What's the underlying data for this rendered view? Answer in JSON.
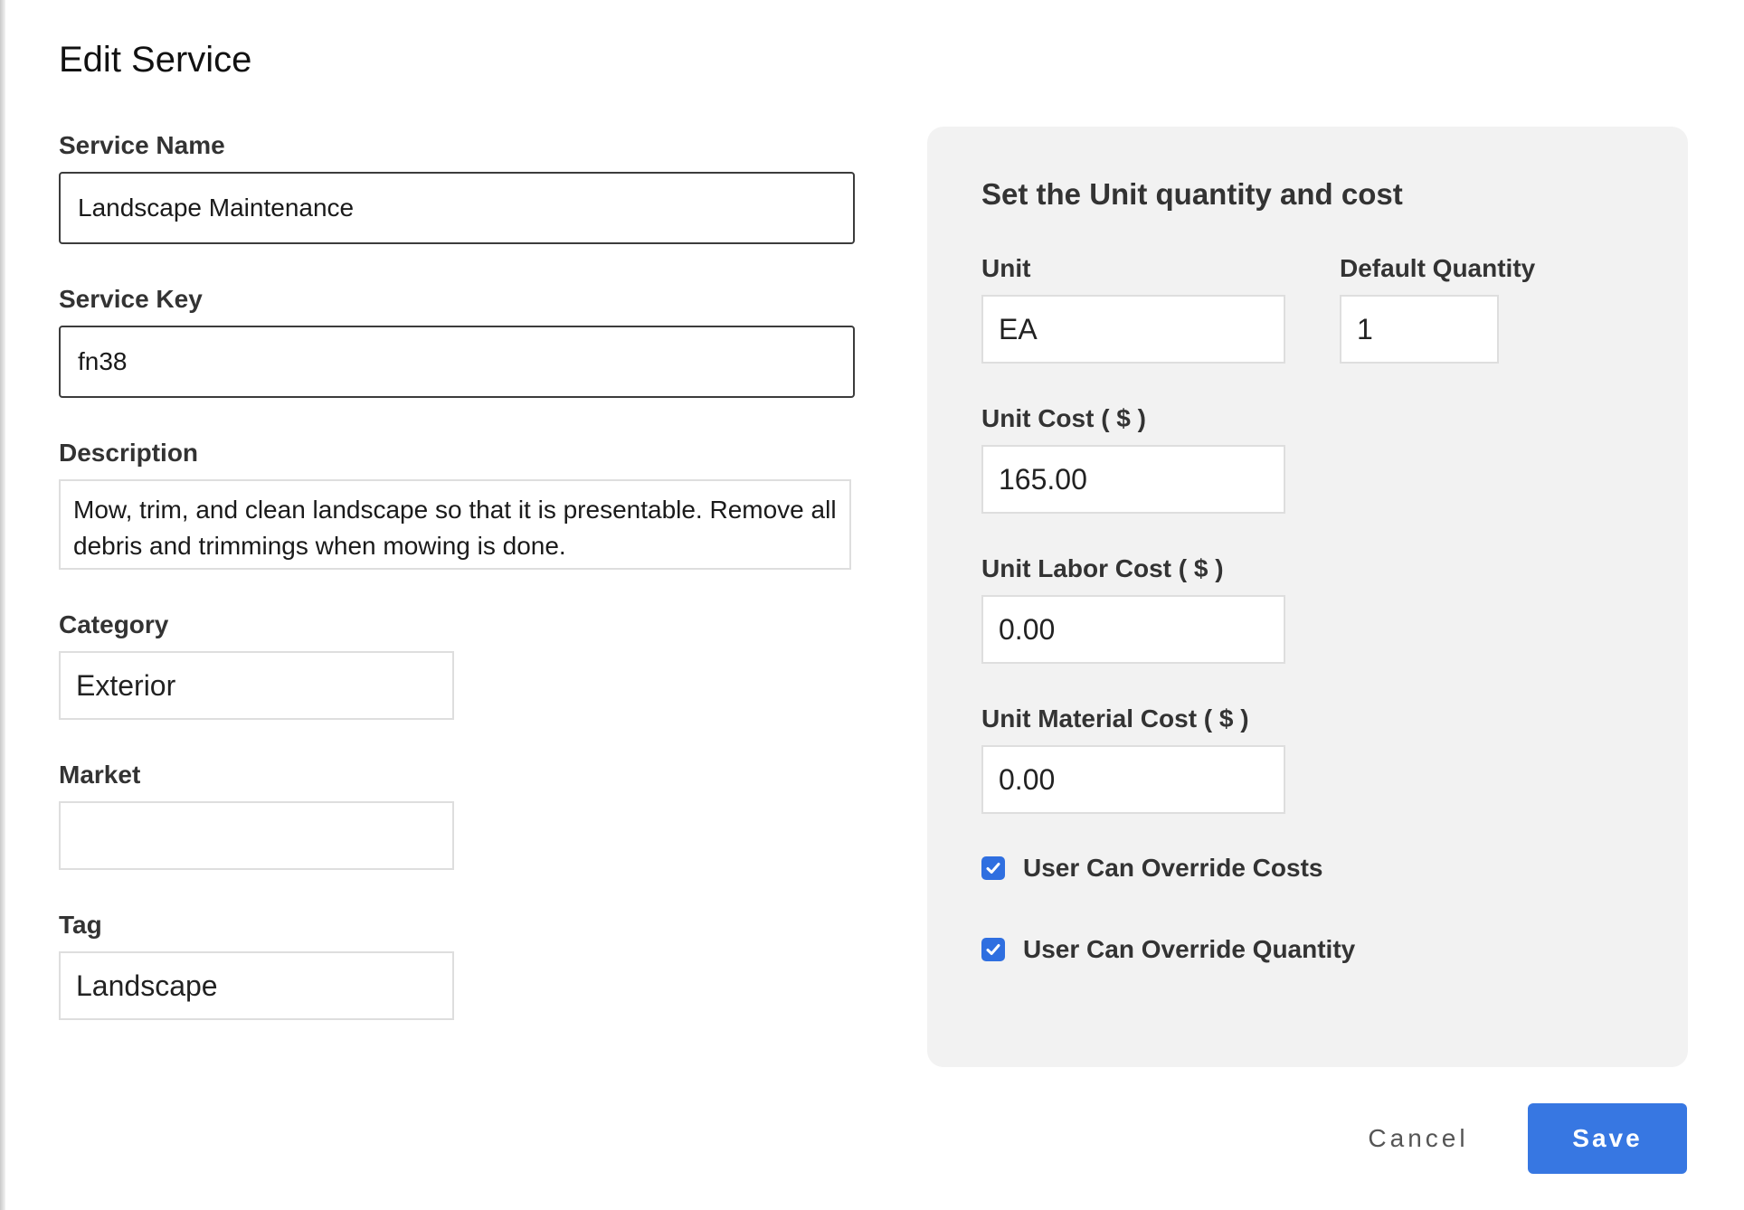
{
  "dialog": {
    "title": "Edit Service"
  },
  "form": {
    "service_name": {
      "label": "Service Name",
      "value": "Landscape Maintenance"
    },
    "service_key": {
      "label": "Service Key",
      "value": "fn38"
    },
    "description": {
      "label": "Description",
      "value": "Mow, trim, and clean landscape so that it is presentable. Remove all debris and trimmings when mowing is done."
    },
    "category": {
      "label": "Category",
      "value": "Exterior"
    },
    "market": {
      "label": "Market",
      "value": ""
    },
    "tag": {
      "label": "Tag",
      "value": "Landscape"
    }
  },
  "unit_panel": {
    "heading": "Set the Unit quantity and cost",
    "unit": {
      "label": "Unit",
      "value": "EA"
    },
    "default_quantity": {
      "label": "Default Quantity",
      "value": "1"
    },
    "unit_cost": {
      "label": "Unit Cost ( $ )",
      "value": "165.00"
    },
    "unit_labor_cost": {
      "label": "Unit Labor Cost ( $ )",
      "value": "0.00"
    },
    "unit_material_cost": {
      "label": "Unit Material Cost ( $ )",
      "value": "0.00"
    },
    "override_costs": {
      "label": "User Can Override Costs",
      "checked": true
    },
    "override_quantity": {
      "label": "User Can Override Quantity",
      "checked": true
    }
  },
  "actions": {
    "cancel_label": "Cancel",
    "save_label": "Save"
  },
  "colors": {
    "accent": "#3777e2",
    "panel_bg": "#f2f2f2",
    "checkbox": "#2f6fe0"
  }
}
